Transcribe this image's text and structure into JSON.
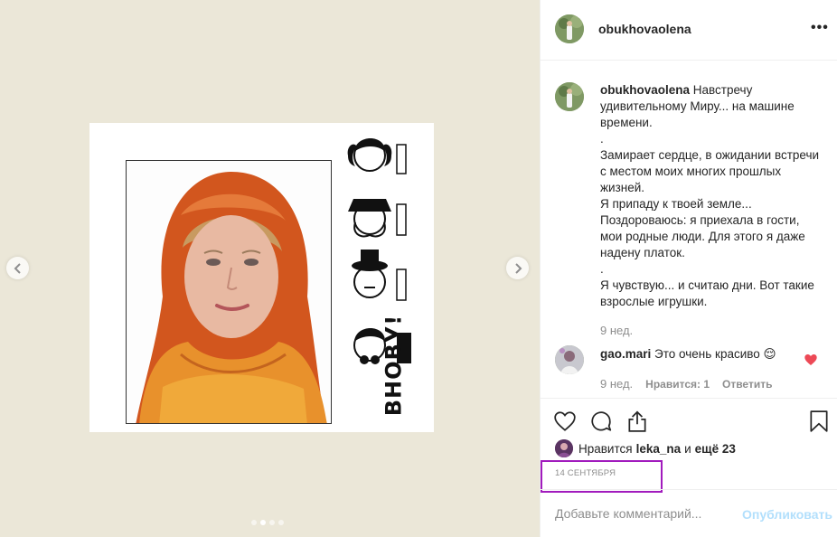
{
  "post": {
    "username": "obukhovaolena",
    "more_label": "•••"
  },
  "media": {
    "overlay_text": "ВНОВУ!",
    "carousel": {
      "slide_count": 4,
      "active_index": 1
    }
  },
  "caption": {
    "username": "obukhovaolena",
    "text": "Навстречу удивительному Миру... на машине времени.\n.\nЗамирает сердце, в ожидании встречи с местом моих многих прошлых жизней.\nЯ припаду к твоей земле...\nПоздороваюсь: я приехала в гости, мои родные люди. Для этого я даже надену платок.\n.\nЯ чувствую... и считаю дни. Вот такие взрослые игрушки.",
    "time": "9 нед."
  },
  "comment": {
    "username": "gao.mari",
    "text": "Это очень красиво 😌",
    "time": "9 нед.",
    "likes_label": "Нравится: 1",
    "reply_label": "Ответить",
    "heart_color": "#ed4956"
  },
  "likes": {
    "prefix": "Нравится",
    "user": "leka_na",
    "connector": "и",
    "others": "ещё 23"
  },
  "date": "14 СЕНТЯБРЯ",
  "comment_box": {
    "placeholder": "Добавьте комментарий...",
    "publish_label": "Опубликовать",
    "publish_color": "#b2dffc"
  },
  "highlight_color": "#a11bbd"
}
